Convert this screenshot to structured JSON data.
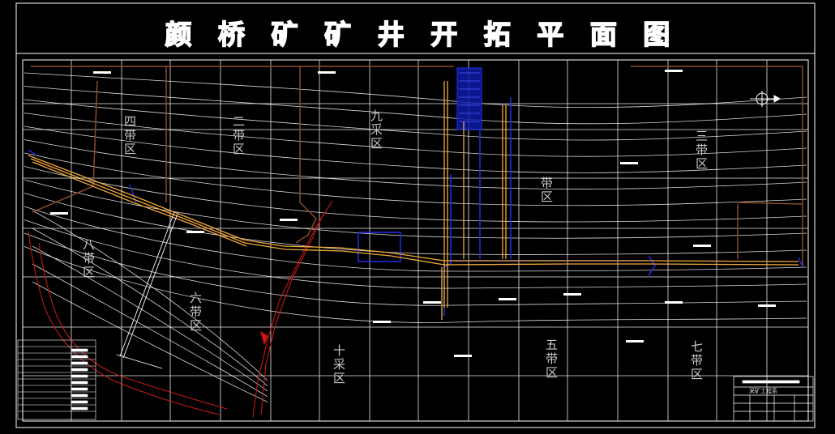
{
  "title": "颜桥矿矿井开拓平面图",
  "title_chars": [
    "颜",
    "桥",
    "矿",
    "矿",
    "井",
    "开",
    "拓",
    "平",
    "面",
    "图"
  ],
  "zones": [
    {
      "id": "si",
      "label": "四带区"
    },
    {
      "id": "er",
      "label": "二带区"
    },
    {
      "id": "jiu",
      "label": "九采区"
    },
    {
      "id": "dai",
      "label": "带区"
    },
    {
      "id": "san",
      "label": "三带区"
    },
    {
      "id": "ba",
      "label": "八带区"
    },
    {
      "id": "liu",
      "label": "六带区"
    },
    {
      "id": "shi",
      "label": "十采区"
    },
    {
      "id": "wu",
      "label": "五带区"
    },
    {
      "id": "qi",
      "label": "七带区"
    }
  ],
  "title_block": {
    "name": "采矿工程系"
  },
  "colors": {
    "background": "#000000",
    "grid": "#ffffff",
    "contour": "#ffffff",
    "roadway": "#f2a93b",
    "boundary_blue": "#1f2bd8",
    "fault_red": "#c21818",
    "boundary_brown": "#8a4a2a"
  }
}
